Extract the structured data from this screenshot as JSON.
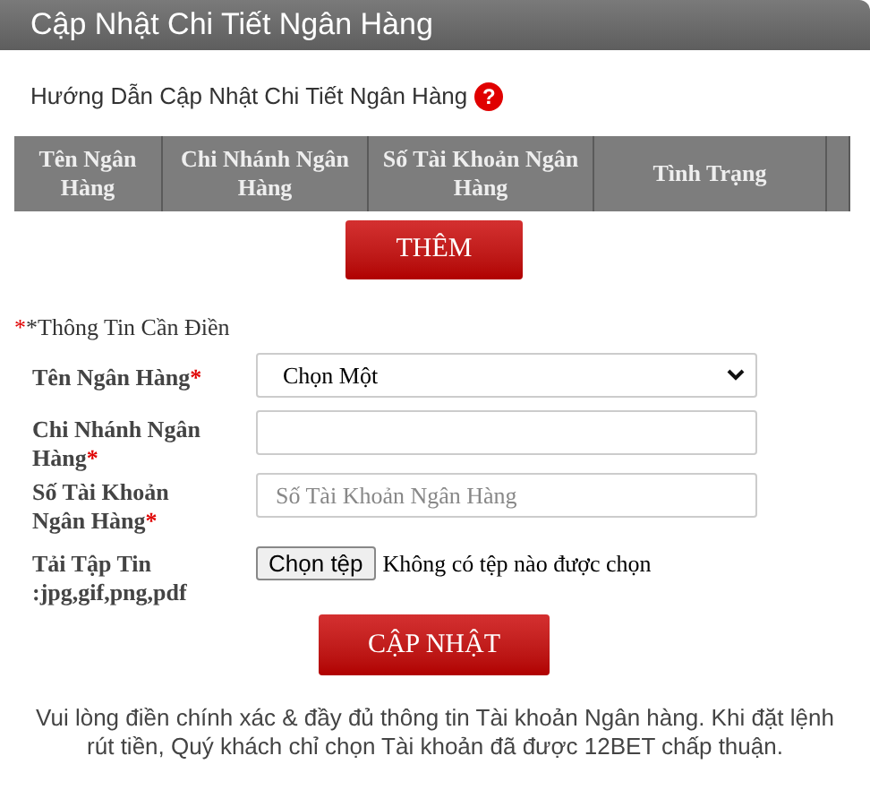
{
  "window": {
    "title": "Cập Nhật Chi Tiết Ngân Hàng"
  },
  "guide": {
    "text": "Hướng Dẫn Cập Nhật Chi Tiết Ngân Hàng",
    "icon": "?"
  },
  "table": {
    "columns": [
      "Tên Ngân Hàng",
      "Chi Nhánh Ngân Hàng",
      "Số Tài Khoản Ngân Hàng",
      "Tình Trạng"
    ]
  },
  "add_button": "THÊM",
  "required_note": {
    "mark": "*",
    "text": "*Thông Tin Cần Điền"
  },
  "fields": [
    {
      "kind": "select",
      "label": "Tên Ngân Hàng",
      "required": true,
      "value": "Chọn Một"
    },
    {
      "kind": "text",
      "label": "Chi Nhánh Ngân Hàng",
      "required": true
    },
    {
      "kind": "text",
      "label": "Số Tài Khoản Ngân Hàng",
      "required": true,
      "placeholder": "Số Tài Khoản Ngân Hàng"
    },
    {
      "kind": "file",
      "label": "Tải Tập Tin :jpg,gif,png,pdf",
      "required": false,
      "button": "Chọn tệp",
      "value": "Không có tệp nào được chọn"
    }
  ],
  "update_button": "CẬP NHẬT",
  "footer": "Vui lòng điền chính xác & đầy đủ thông tin Tài khoản Ngân hàng. Khi đặt lệnh rút tiền, Quý khách chỉ chọn Tài khoản đã được 12BET chấp thuận."
}
